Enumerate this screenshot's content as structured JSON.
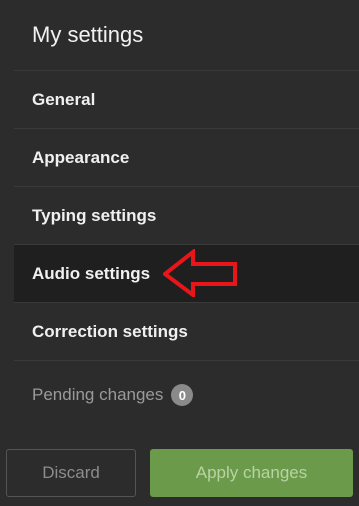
{
  "header": {
    "title": "My settings"
  },
  "menu": {
    "items": [
      {
        "label": "General"
      },
      {
        "label": "Appearance"
      },
      {
        "label": "Typing settings"
      },
      {
        "label": "Audio settings"
      },
      {
        "label": "Correction settings"
      }
    ]
  },
  "pending": {
    "label": "Pending changes",
    "count": "0"
  },
  "actions": {
    "discard_label": "Discard",
    "apply_label": "Apply changes"
  },
  "colors": {
    "background": "#2c2c2c",
    "active_item": "#1f1f1f",
    "apply_button": "#6a9a4a",
    "annotation_arrow": "#e8151b"
  },
  "annotation": {
    "icon": "red-left-arrow-icon"
  }
}
